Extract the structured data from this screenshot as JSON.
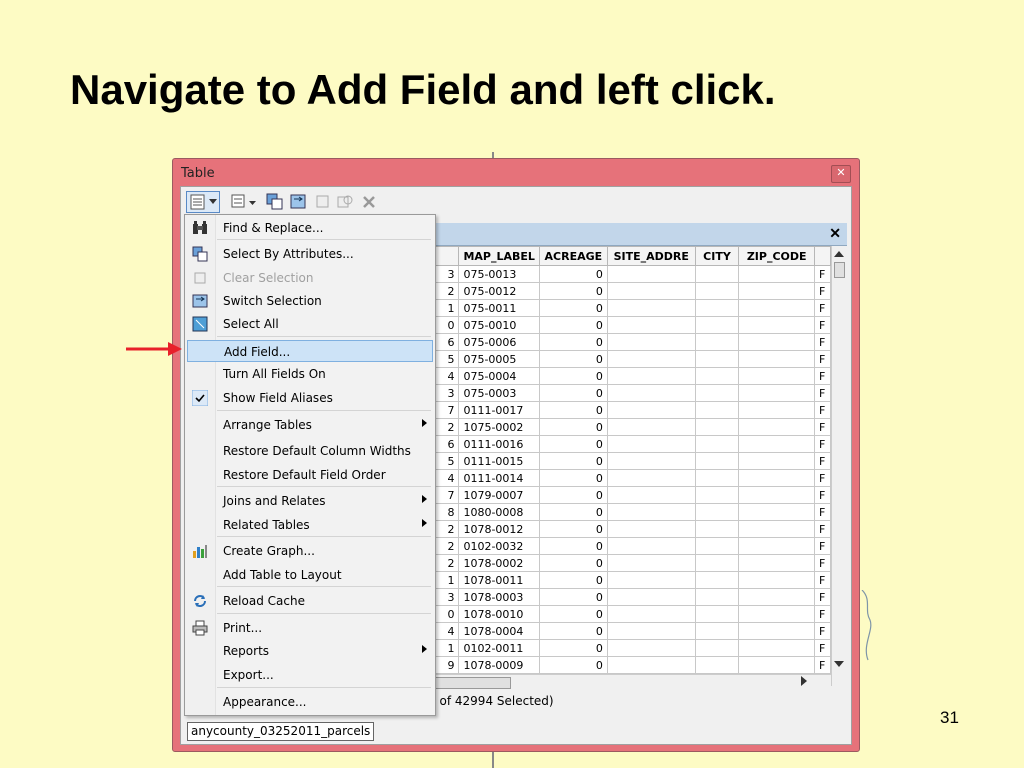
{
  "slide": {
    "title": "Navigate to Add Field and left click.",
    "page_number": "31"
  },
  "window": {
    "title": "Table",
    "close_glyph": "✕",
    "tab_close_glyph": "✕",
    "status_text": "t of 42994 Selected)",
    "layer_name": "anycounty_03252011_parcels"
  },
  "toolbar": {
    "icons": [
      "table-options-icon",
      "related-tables-icon",
      "select-by-attributes-icon",
      "switch-selection-icon",
      "clear-selection-icon",
      "zoom-to-selected-icon",
      "delete-selected-icon"
    ]
  },
  "menu": {
    "items": [
      {
        "label": "Find & Replace...",
        "icon": "binoculars-icon",
        "enabled": true,
        "submenu": false
      },
      {
        "label": "Select By Attributes...",
        "icon": "select-by-attributes-icon",
        "enabled": true,
        "submenu": false
      },
      {
        "label": "Clear Selection",
        "icon": "clear-selection-icon",
        "enabled": false,
        "submenu": false
      },
      {
        "label": "Switch Selection",
        "icon": "switch-selection-icon",
        "enabled": true,
        "submenu": false
      },
      {
        "label": "Select All",
        "icon": "select-all-icon",
        "enabled": true,
        "submenu": false
      },
      {
        "label": "Add Field...",
        "icon": "",
        "enabled": true,
        "submenu": false,
        "highlighted": true
      },
      {
        "label": "Turn All Fields On",
        "icon": "",
        "enabled": true,
        "submenu": false
      },
      {
        "label": "Show Field Aliases",
        "icon": "checkmark-icon",
        "enabled": true,
        "submenu": false
      },
      {
        "label": "Arrange Tables",
        "icon": "",
        "enabled": true,
        "submenu": true
      },
      {
        "label": "Restore Default Column Widths",
        "icon": "",
        "enabled": true,
        "submenu": false
      },
      {
        "label": "Restore Default Field Order",
        "icon": "",
        "enabled": true,
        "submenu": false
      },
      {
        "label": "Joins and Relates",
        "icon": "",
        "enabled": true,
        "submenu": true
      },
      {
        "label": "Related Tables",
        "icon": "",
        "enabled": true,
        "submenu": true
      },
      {
        "label": "Create Graph...",
        "icon": "bar-graph-icon",
        "enabled": true,
        "submenu": false
      },
      {
        "label": "Add Table to Layout",
        "icon": "",
        "enabled": true,
        "submenu": false
      },
      {
        "label": "Reload Cache",
        "icon": "reload-icon",
        "enabled": true,
        "submenu": false
      },
      {
        "label": "Print...",
        "icon": "printer-icon",
        "enabled": true,
        "submenu": false
      },
      {
        "label": "Reports",
        "icon": "",
        "enabled": true,
        "submenu": true
      },
      {
        "label": "Export...",
        "icon": "",
        "enabled": true,
        "submenu": false
      },
      {
        "label": "Appearance...",
        "icon": "",
        "enabled": true,
        "submenu": false
      }
    ]
  },
  "grid": {
    "columns": [
      "MAP_LABEL",
      "ACREAGE",
      "SITE_ADDRE",
      "CITY",
      "ZIP_CODE"
    ],
    "rows": [
      {
        "partial": "3",
        "map_label": "075-0013",
        "acreage": "0",
        "tail": "F"
      },
      {
        "partial": "2",
        "map_label": "075-0012",
        "acreage": "0",
        "tail": "F"
      },
      {
        "partial": "1",
        "map_label": "075-0011",
        "acreage": "0",
        "tail": "F"
      },
      {
        "partial": "0",
        "map_label": "075-0010",
        "acreage": "0",
        "tail": "F"
      },
      {
        "partial": "6",
        "map_label": "075-0006",
        "acreage": "0",
        "tail": "F"
      },
      {
        "partial": "5",
        "map_label": "075-0005",
        "acreage": "0",
        "tail": "F"
      },
      {
        "partial": "4",
        "map_label": "075-0004",
        "acreage": "0",
        "tail": "F"
      },
      {
        "partial": "3",
        "map_label": "075-0003",
        "acreage": "0",
        "tail": "F"
      },
      {
        "partial": "7",
        "map_label": "0111-0017",
        "acreage": "0",
        "tail": "F"
      },
      {
        "partial": "2",
        "map_label": "1075-0002",
        "acreage": "0",
        "tail": "F"
      },
      {
        "partial": "6",
        "map_label": "0111-0016",
        "acreage": "0",
        "tail": "F"
      },
      {
        "partial": "5",
        "map_label": "0111-0015",
        "acreage": "0",
        "tail": "F"
      },
      {
        "partial": "4",
        "map_label": "0111-0014",
        "acreage": "0",
        "tail": "F"
      },
      {
        "partial": "7",
        "map_label": "1079-0007",
        "acreage": "0",
        "tail": "F"
      },
      {
        "partial": "8",
        "map_label": "1080-0008",
        "acreage": "0",
        "tail": "F"
      },
      {
        "partial": "2",
        "map_label": "1078-0012",
        "acreage": "0",
        "tail": "F"
      },
      {
        "partial": "2",
        "map_label": "0102-0032",
        "acreage": "0",
        "tail": "F"
      },
      {
        "partial": "2",
        "map_label": "1078-0002",
        "acreage": "0",
        "tail": "F"
      },
      {
        "partial": "1",
        "map_label": "1078-0011",
        "acreage": "0",
        "tail": "F"
      },
      {
        "partial": "3",
        "map_label": "1078-0003",
        "acreage": "0",
        "tail": "F"
      },
      {
        "partial": "0",
        "map_label": "1078-0010",
        "acreage": "0",
        "tail": "F"
      },
      {
        "partial": "4",
        "map_label": "1078-0004",
        "acreage": "0",
        "tail": "F"
      },
      {
        "partial": "1",
        "map_label": "0102-0011",
        "acreage": "0",
        "tail": "F"
      },
      {
        "partial": "9",
        "map_label": "1078-0009",
        "acreage": "0",
        "tail": "F"
      }
    ]
  },
  "colors": {
    "slide_background": "#fdfbc4",
    "window_frame": "#e6727a",
    "menu_highlight": "#cde3f7",
    "arrow": "#e8202a"
  }
}
